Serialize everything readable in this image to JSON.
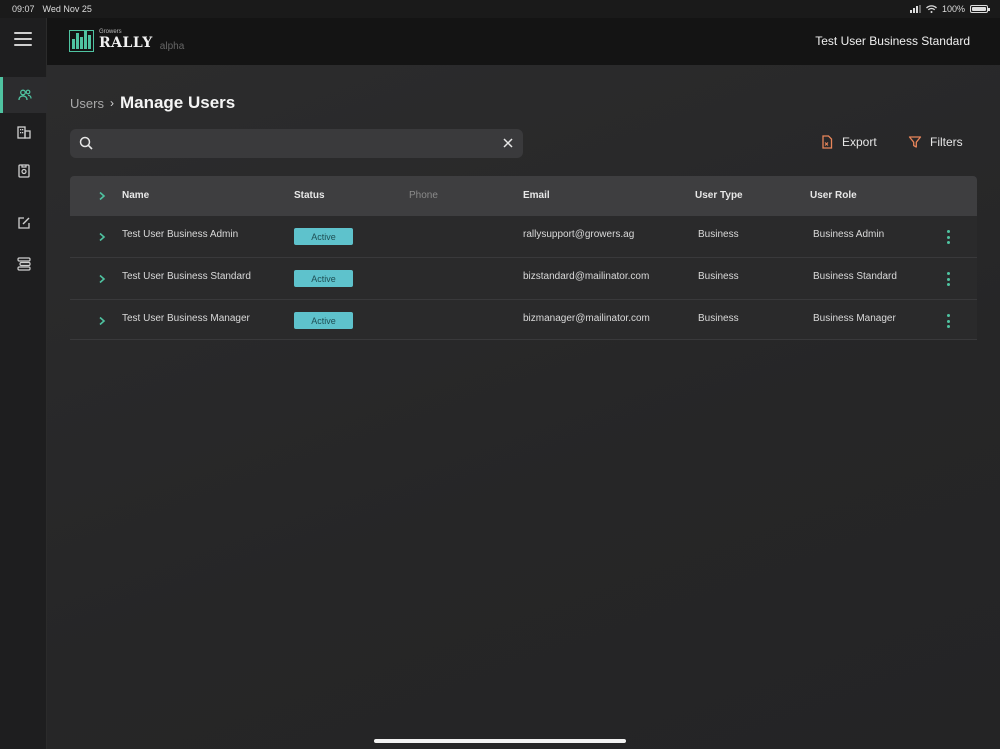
{
  "status_bar": {
    "time": "09:07",
    "date": "Wed Nov 25",
    "battery": "100%"
  },
  "header": {
    "logo_small": "Growers",
    "logo_big": "RALLY",
    "logo_tag": "alpha",
    "user_name": "Test User Business Standard"
  },
  "sidebar": {
    "items": [
      {
        "icon": "users-icon",
        "active": true
      },
      {
        "icon": "building-icon",
        "active": false
      },
      {
        "icon": "document-icon",
        "active": false
      },
      {
        "icon": "edit-icon",
        "active": false
      },
      {
        "icon": "list-icon",
        "active": false
      }
    ]
  },
  "breadcrumb": {
    "parent": "Users",
    "separator": "›",
    "current": "Manage Users"
  },
  "search": {
    "value": "",
    "placeholder": ""
  },
  "toolbar": {
    "export_label": "Export",
    "filters_label": "Filters"
  },
  "table": {
    "columns": [
      "Name",
      "Status",
      "Phone",
      "Email",
      "User Type",
      "User Role"
    ],
    "rows": [
      {
        "name": "Test User Business Admin",
        "status": "Active",
        "phone": "",
        "email": "rallysupport@growers.ag",
        "user_type": "Business",
        "user_role": "Business Admin"
      },
      {
        "name": "Test User Business Standard",
        "status": "Active",
        "phone": "",
        "email": "bizstandard@mailinator.com",
        "user_type": "Business",
        "user_role": "Business Standard"
      },
      {
        "name": "Test User Business Manager",
        "status": "Active",
        "phone": "",
        "email": "bizmanager@mailinator.com",
        "user_type": "Business",
        "user_role": "Business Manager"
      }
    ]
  },
  "colors": {
    "accent": "#4fc3a1",
    "status_active_bg": "#5ec2cc",
    "toolbar_icon": "#e8855a",
    "header_bg": "#141414",
    "table_header_bg": "#3e3e40"
  }
}
